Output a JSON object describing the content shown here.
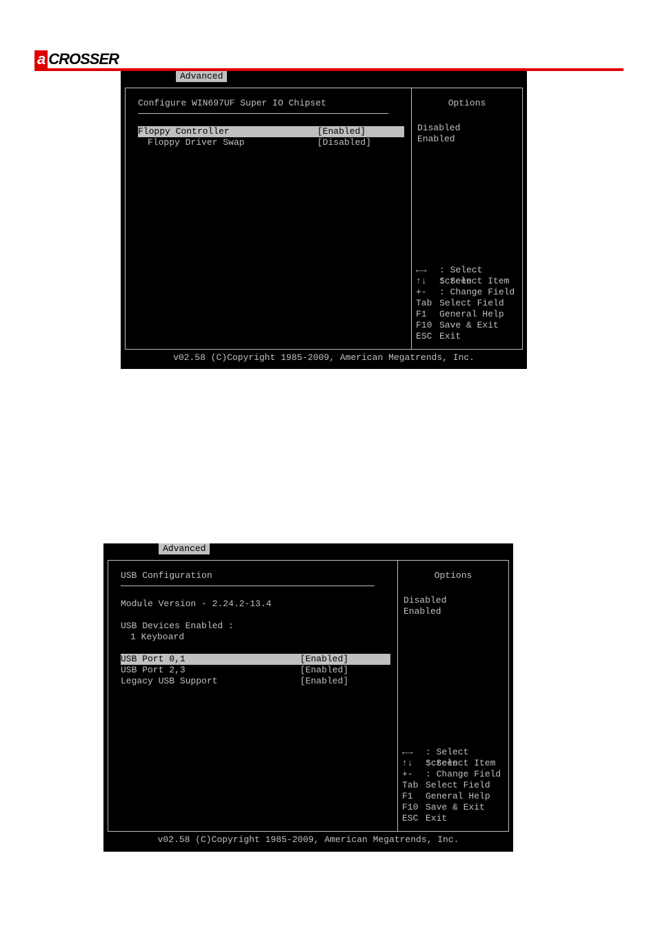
{
  "logo": {
    "prefix": "a",
    "rest": "CROSSER"
  },
  "bios1": {
    "tab": "Advanced",
    "title": "Configure WIN697UF Super IO Chipset",
    "settings": [
      {
        "label": "Floppy Controller",
        "value": "[Enabled]",
        "selected": true
      },
      {
        "label": "Floppy Driver Swap",
        "value": "[Disabled]",
        "selected": false,
        "indent": true
      }
    ],
    "options_title": "Options",
    "options": [
      "Disabled",
      "Enabled"
    ],
    "help": [
      {
        "key": "←→",
        "text": ": Select Screen"
      },
      {
        "key": "↑↓",
        "text": ": Select Item"
      },
      {
        "key": "+-",
        "text": ": Change Field"
      },
      {
        "key": "Tab",
        "text": "Select Field"
      },
      {
        "key": "F1",
        "text": "General Help"
      },
      {
        "key": "F10",
        "text": "Save & Exit"
      },
      {
        "key": "ESC",
        "text": "Exit"
      }
    ],
    "copyright": "v02.58 (C)Copyright 1985-2009, American Megatrends, Inc."
  },
  "bios2": {
    "tab": "Advanced",
    "title": "USB Configuration",
    "info1": "Module Version - 2.24.2-13.4",
    "info2_label": "USB Devices Enabled :",
    "info2_value": "1 Keyboard",
    "settings": [
      {
        "label": "USB Port 0,1",
        "value": "[Enabled]",
        "selected": true
      },
      {
        "label": "USB Port 2,3",
        "value": "[Enabled]",
        "selected": false
      },
      {
        "label": "Legacy USB Support",
        "value": "[Enabled]",
        "selected": false
      }
    ],
    "options_title": "Options",
    "options": [
      "Disabled",
      "Enabled"
    ],
    "help": [
      {
        "key": "←→",
        "text": ": Select Screen"
      },
      {
        "key": "↑↓",
        "text": ": Select Item"
      },
      {
        "key": "+-",
        "text": ": Change Field"
      },
      {
        "key": "Tab",
        "text": "Select Field"
      },
      {
        "key": "F1",
        "text": "General Help"
      },
      {
        "key": "F10",
        "text": "Save & Exit"
      },
      {
        "key": "ESC",
        "text": "Exit"
      }
    ],
    "copyright": "v02.58 (C)Copyright 1985-2009, American Megatrends, Inc."
  }
}
